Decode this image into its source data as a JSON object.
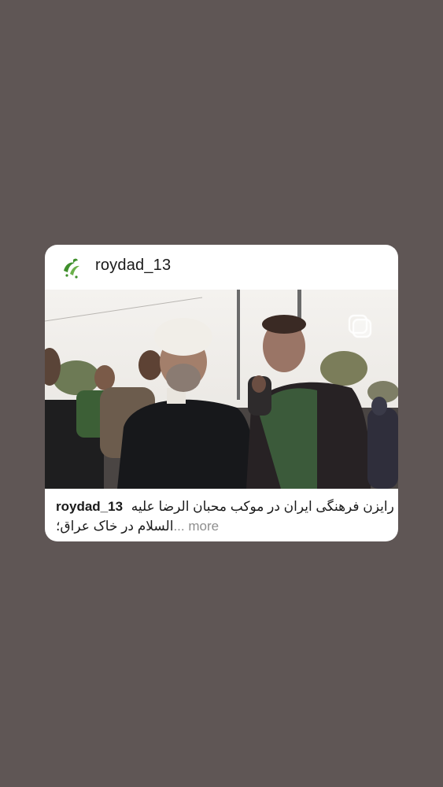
{
  "post": {
    "username": "roydad_13",
    "logo_text": "رویداد",
    "caption_user": "roydad_13",
    "caption_line1": "رایزن فرهنگی ایران در موکب محبان الرضا علیه",
    "caption_line2": "السلام در خاک عراق؛",
    "more_prefix": "... ",
    "more_label": "more",
    "image_icon": "multiple-images-icon",
    "avatar_icon": "roydad-logo-icon"
  },
  "colors": {
    "background": "#5f5655",
    "card": "#ffffff",
    "text": "#1a1a1a",
    "more": "#8e8e8e",
    "logo_green": "#3f8f2c"
  }
}
